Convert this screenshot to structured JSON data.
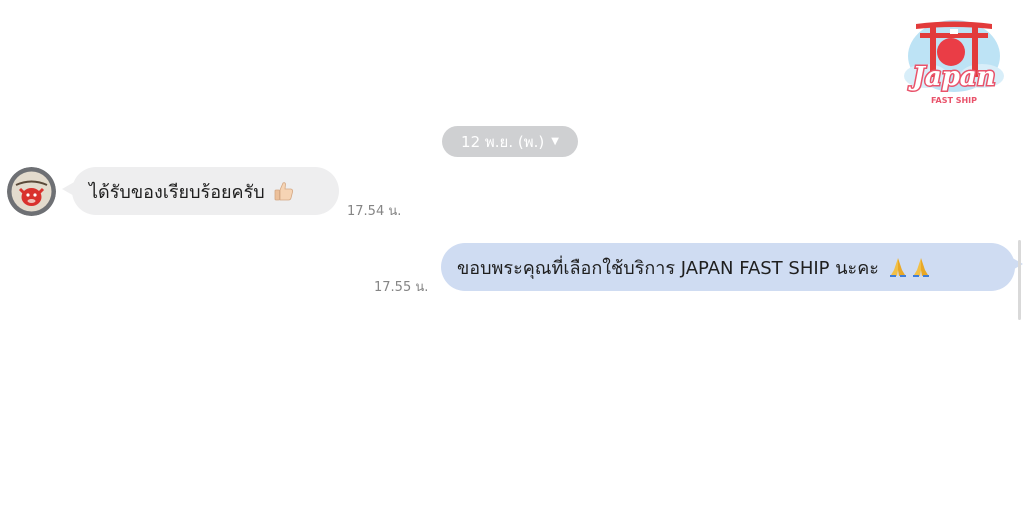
{
  "logo": {
    "main_text": "Japan",
    "sub_text": "FAST SHIP"
  },
  "date_separator": {
    "label": "12 พ.ย. (พ.)"
  },
  "messages": [
    {
      "direction": "incoming",
      "text": "ได้รับของเรียบร้อยครับ",
      "emoji": "thumbs-up",
      "time": "17.54 น."
    },
    {
      "direction": "outgoing",
      "text": "ขอบพระคุณที่เลือกใช้บริการ JAPAN FAST SHIP นะคะ",
      "emoji": "folded-hands x2",
      "time": "17.55 น."
    }
  ],
  "colors": {
    "incoming_bubble": "#eeeeef",
    "outgoing_bubble": "#cfdcf2",
    "date_chip": "#cfd0d2",
    "timestamp": "#858585"
  }
}
